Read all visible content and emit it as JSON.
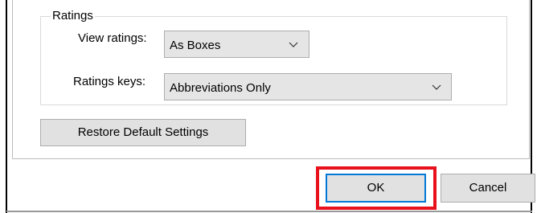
{
  "ratings_group": {
    "legend": "Ratings",
    "view_ratings": {
      "label": "View ratings:",
      "value": "As Boxes"
    },
    "ratings_keys": {
      "label": "Ratings keys:",
      "value": "Abbreviations Only"
    }
  },
  "restore_button": {
    "label": "Restore Default Settings"
  },
  "dialog_buttons": {
    "ok_label": "OK",
    "cancel_label": "Cancel"
  },
  "colors": {
    "highlight": "#e8101b",
    "default_button_border": "#0078d7",
    "button_face": "#e1e1e1"
  },
  "icons": {
    "combo_arrow": "chevron-down-icon"
  }
}
